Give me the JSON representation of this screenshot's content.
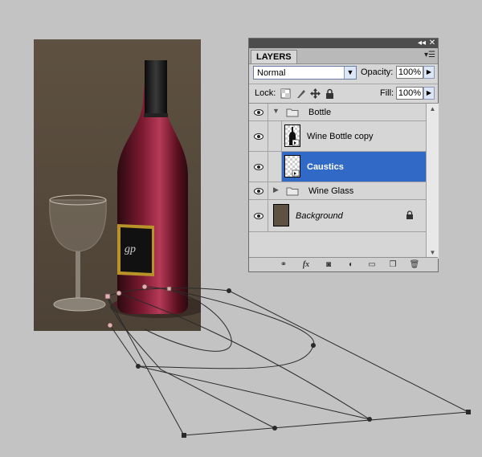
{
  "panel": {
    "tab_label": "LAYERS",
    "blend_mode": "Normal",
    "opacity_label": "Opacity:",
    "opacity_value": "100%",
    "lock_label": "Lock:",
    "fill_label": "Fill:",
    "fill_value": "100%"
  },
  "layers": [
    {
      "name": "Bottle",
      "kind": "group",
      "expanded": true
    },
    {
      "name": "Wine Bottle copy",
      "kind": "layer"
    },
    {
      "name": "Caustics",
      "kind": "layer",
      "selected": true
    },
    {
      "name": "Wine Glass",
      "kind": "group",
      "expanded": false
    },
    {
      "name": "Background",
      "kind": "background",
      "locked": true
    }
  ],
  "footer_icons": [
    "link-icon",
    "fx-icon",
    "mask-icon",
    "adjustment-icon",
    "new-group-icon",
    "new-layer-icon",
    "trash-icon"
  ],
  "colors": {
    "selection": "#3169c6",
    "canvas_bg": "#5e5141",
    "workspace": "#c3c3c3",
    "wine": "#6b1024"
  }
}
